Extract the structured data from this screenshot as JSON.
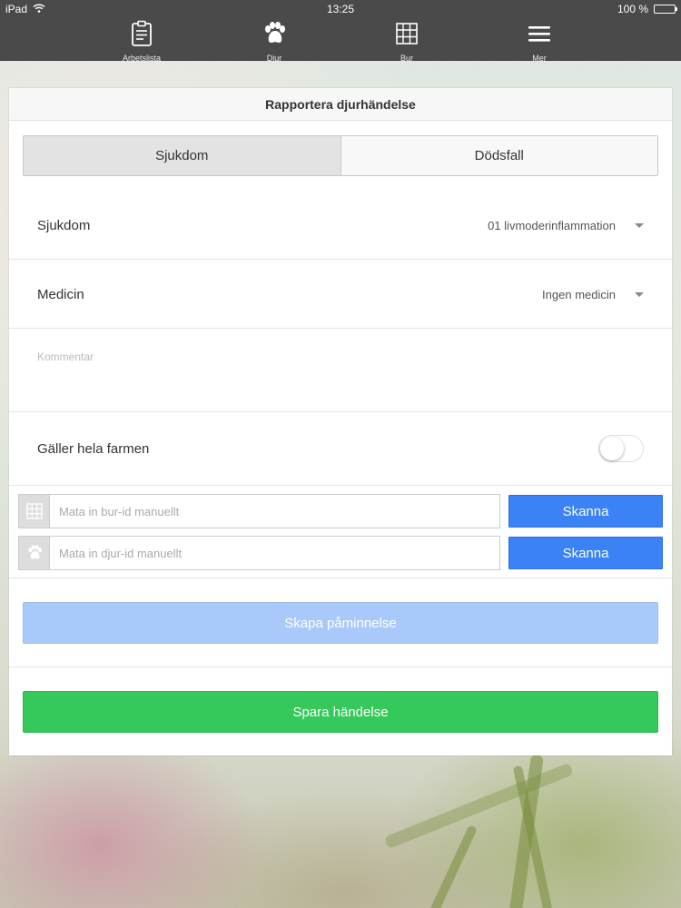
{
  "status_bar": {
    "device": "iPad",
    "time": "13:25",
    "battery_text": "100 %",
    "battery_level": 1.0
  },
  "tabs": [
    {
      "label": "Arbetslista",
      "icon": "clipboard-icon"
    },
    {
      "label": "Djur",
      "icon": "paw-icon"
    },
    {
      "label": "Bur",
      "icon": "grid-icon"
    },
    {
      "label": "Mer",
      "icon": "menu-icon"
    }
  ],
  "form": {
    "title": "Rapportera djurhändelse",
    "segments": [
      "Sjukdom",
      "Dödsfall"
    ],
    "active_segment": "Sjukdom",
    "disease": {
      "label": "Sjukdom",
      "value": "01 livmoderinflammation"
    },
    "medicine": {
      "label": "Medicin",
      "value": "Ingen medicin"
    },
    "comment_placeholder": "Kommentar",
    "whole_farm": {
      "label": "Gäller hela farmen",
      "on": false
    },
    "cage_id": {
      "placeholder": "Mata in bur-id manuellt",
      "scan_label": "Skanna"
    },
    "animal_id": {
      "placeholder": "Mata in djur-id manuellt",
      "scan_label": "Skanna"
    },
    "reminder_label": "Skapa påminnelse",
    "save_label": "Spara händelse"
  },
  "colors": {
    "bar_bg": "#4a4a4a",
    "scan_blue": "#3a82f6",
    "reminder_disabled": "#aac9fb",
    "save_green": "#35c85a"
  }
}
